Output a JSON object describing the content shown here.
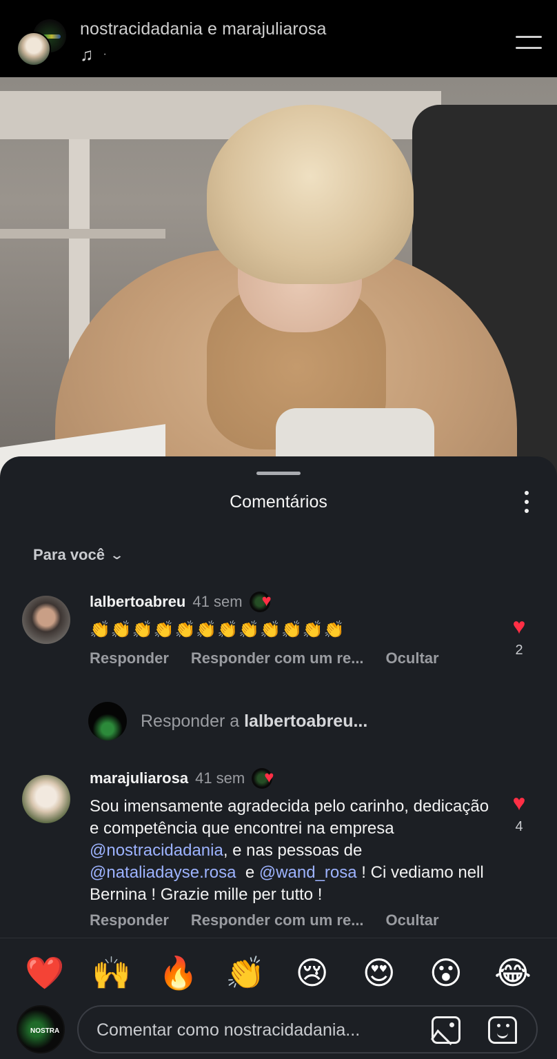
{
  "header": {
    "title": "nostracidadania e marajuliarosa",
    "music_dot": "·"
  },
  "sheet": {
    "title": "Comentários",
    "filter": "Para você"
  },
  "comments": [
    {
      "user": "lalbertoabreu",
      "time": "41 sem",
      "text": "👏👏👏👏👏👏👏👏👏👏👏👏",
      "likes": "2",
      "actions": [
        "Responder",
        "Responder com um re...",
        "Ocultar"
      ]
    },
    {
      "user": "marajuliarosa",
      "time": "41 sem",
      "text_parts": [
        "Sou imensamente agradecida pelo carinho, dedicação e competência que encontrei na empresa ",
        "@nostracidadania",
        ", e nas pessoas de ",
        "@nataliadayse.rosa",
        "  e ",
        "@wand_rosa",
        " ! Ci vediamo nell Bernina ! Grazie mille per tutto !"
      ],
      "likes": "4",
      "actions": [
        "Responder",
        "Responder com um re...",
        "Ocultar"
      ]
    }
  ],
  "reply_prompt": {
    "prefix": "Responder a ",
    "user": "lalbertoabreu..."
  },
  "emoji_bar": [
    "❤️",
    "🙌",
    "🔥",
    "👏",
    "😢",
    "😍",
    "😮",
    "😂"
  ],
  "input": {
    "placeholder": "Comentar como nostracidadania...",
    "avatar_label": "NOSTRA"
  }
}
